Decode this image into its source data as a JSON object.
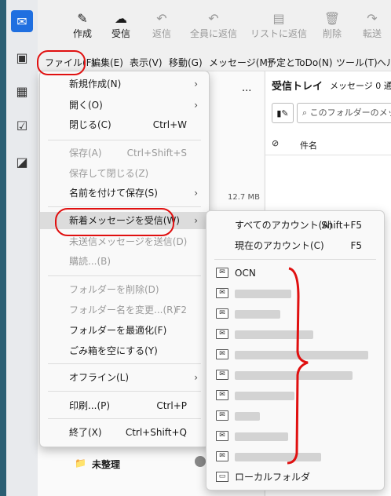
{
  "toolbar": {
    "compose": "作成",
    "receive": "受信",
    "reply": "返信",
    "reply_all": "全員に返信",
    "reply_list": "リストに返信",
    "delete": "削除",
    "forward": "転送"
  },
  "menubar": [
    "ファイル(F)",
    "編集(E)",
    "表示(V)",
    "移動(G)",
    "メッセージ(M)",
    "予定とToDo(N)",
    "ツール(T)",
    "ヘル"
  ],
  "file_menu": {
    "new": "新規作成(N)",
    "open": "開く(O)",
    "close": "閉じる(C)",
    "close_shortcut": "Ctrl+W",
    "save": "保存(A)",
    "save_shortcut": "Ctrl+Shift+S",
    "save_close": "保存して閉じる(Z)",
    "save_as": "名前を付けて保存(S)",
    "get_new": "新着メッセージを受信(W)",
    "send_unsent": "未送信メッセージを送信(D)",
    "subscribe": "購読...(B)",
    "delete_folder": "フォルダーを削除(D)",
    "rename_folder": "フォルダー名を変更...(R)",
    "rename_shortcut": "F2",
    "compact": "フォルダーを最適化(F)",
    "empty_trash": "ごみ箱を空にする(Y)",
    "offline": "オフライン(L)",
    "print": "印刷...(P)",
    "print_shortcut": "Ctrl+P",
    "quit": "終了(X)",
    "quit_shortcut": "Ctrl+Shift+Q"
  },
  "receive_submenu": {
    "all_accounts": "すべてのアカウント(A)",
    "all_shortcut": "Shift+F5",
    "current_account": "現在のアカウント(C)",
    "current_shortcut": "F5",
    "account_ocn": "OCN",
    "local_folders": "ローカルフォルダ"
  },
  "folder_pane": {
    "size": "12.7 MB",
    "unsorted": "未整理",
    "more": "..."
  },
  "message_pane": {
    "title": "受信トレイ",
    "count": "メッセージ 0 通",
    "search_placeholder": "このフォルダーのメッ",
    "subject_col": "件名"
  }
}
